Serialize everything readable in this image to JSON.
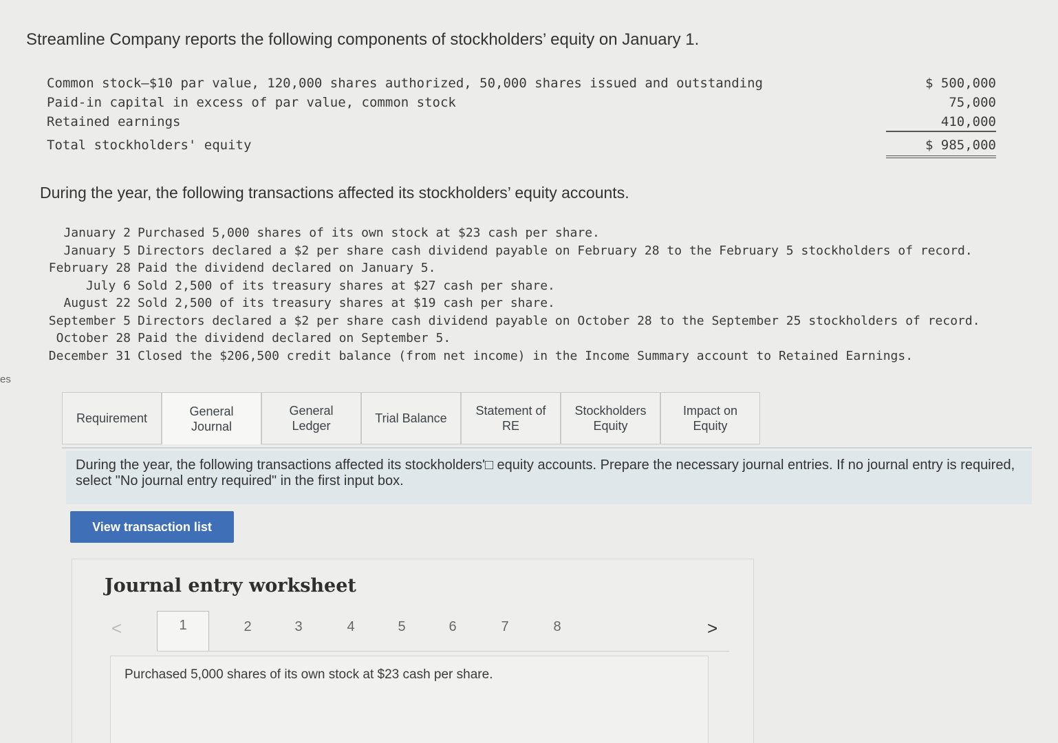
{
  "side_edge_text": "es",
  "intro": "Streamline Company reports the following components of stockholders’ equity on January 1.",
  "equity": [
    {
      "label": "Common stock–$10 par value, 120,000 shares authorized, 50,000 shares issued and outstanding",
      "amount": "$ 500,000"
    },
    {
      "label": "Paid-in capital in excess of par value, common stock",
      "amount": "75,000"
    },
    {
      "label": "Retained earnings",
      "amount": "410,000"
    },
    {
      "label": "Total stockholders' equity",
      "amount": "$ 985,000"
    }
  ],
  "during_heading": "During the year, the following transactions affected its stockholders’ equity accounts.",
  "transactions": [
    {
      "date": "January 2",
      "text": "Purchased 5,000 shares of its own stock at $23 cash per share."
    },
    {
      "date": "January 5",
      "text": "Directors declared a $2 per share cash dividend payable on February 28 to the February 5 stockholders of record."
    },
    {
      "date": "February 28",
      "text": "Paid the dividend declared on January 5."
    },
    {
      "date": "July 6",
      "text": "Sold 2,500 of its treasury shares at $27 cash per share."
    },
    {
      "date": "August 22",
      "text": "Sold 2,500 of its treasury shares at $19 cash per share."
    },
    {
      "date": "September 5",
      "text": "Directors declared a $2 per share cash dividend payable on October 28 to the September 25 stockholders of record."
    },
    {
      "date": "October 28",
      "text": "Paid the dividend declared on September 5."
    },
    {
      "date": "December 31",
      "text": "Closed the $206,500 credit balance (from net income) in the Income Summary account to Retained Earnings."
    }
  ],
  "tabs": [
    {
      "line1": "Requirement",
      "line2": ""
    },
    {
      "line1": "General",
      "line2": "Journal"
    },
    {
      "line1": "General",
      "line2": "Ledger"
    },
    {
      "line1": "Trial Balance",
      "line2": ""
    },
    {
      "line1": "Statement of",
      "line2": "RE"
    },
    {
      "line1": "Stockholders",
      "line2": "Equity"
    },
    {
      "line1": "Impact on",
      "line2": "Equity"
    }
  ],
  "active_tab_index": 1,
  "instruction": "During the year, the following transactions affected its stockholders'□ equity accounts. Prepare the necessary journal entries. If no journal entry is required, select \"No journal entry required\" in the first input box.",
  "view_button_label": "View transaction list",
  "worksheet_title": "Journal entry worksheet",
  "pager": {
    "prev": "<",
    "next": ">",
    "pages": [
      "1",
      "2",
      "3",
      "4",
      "5",
      "6",
      "7",
      "8"
    ],
    "active_page": "1"
  },
  "current_transaction": "Purchased 5,000 shares of its own stock at $23 cash per share."
}
